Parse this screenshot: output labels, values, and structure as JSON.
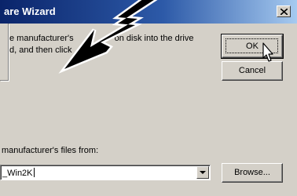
{
  "window": {
    "title": "are Wizard"
  },
  "message": {
    "line1": "e manufacturer's",
    "line1_tail": "on disk into the drive",
    "line2": "d, and then click"
  },
  "buttons": {
    "ok": "OK",
    "cancel": "Cancel",
    "browse": "Browse..."
  },
  "copy_from": {
    "label": "manufacturer's files from:",
    "value": "_Win2K"
  },
  "colors": {
    "title_gradient_start": "#0a246a",
    "title_gradient_end": "#a6caf0",
    "dialog_bg": "#d4d0c8"
  },
  "icons": {
    "close": "close-icon",
    "dropdown": "chevron-down-icon",
    "cursor": "mouse-pointer-icon",
    "annotation": "lightning-arrow-icon"
  }
}
